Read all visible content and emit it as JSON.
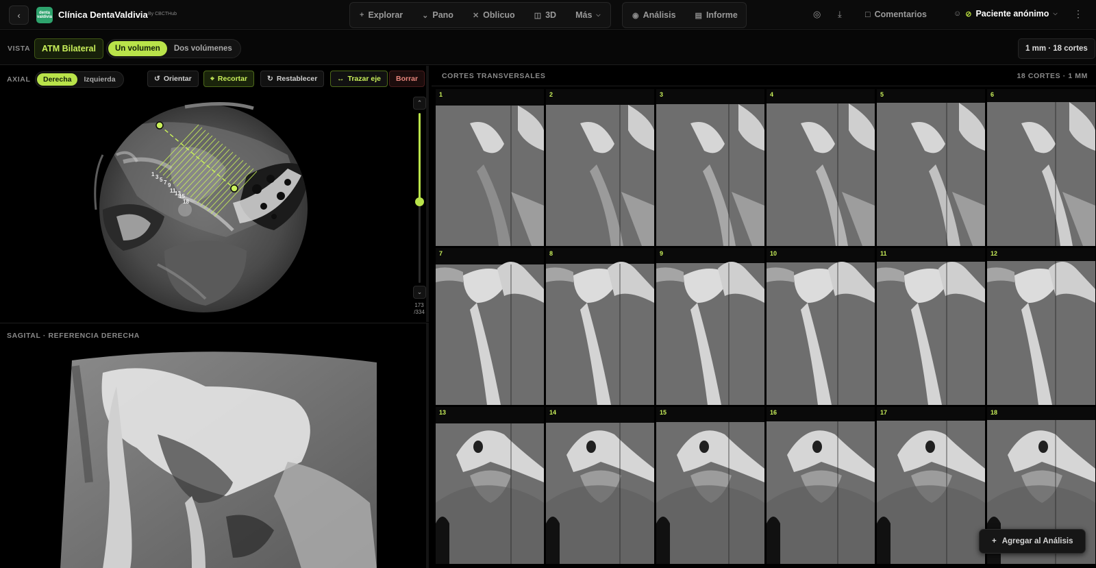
{
  "header": {
    "logo_text": "dental\nvaldivia",
    "brand": "Clínica DentaValdivia",
    "brand_sub": "By CBCTHub",
    "nav": [
      {
        "label": "Explorar",
        "icon": "plus-icon"
      },
      {
        "label": "Pano",
        "icon": "pano-curve-icon"
      },
      {
        "label": "Oblicuo",
        "icon": "oblique-cross-icon"
      },
      {
        "label": "3D",
        "icon": "cube-icon"
      },
      {
        "label": "Más",
        "icon": "chevron-down-icon"
      }
    ],
    "nav2": [
      {
        "label": "Análisis",
        "icon": "eye-icon"
      },
      {
        "label": "Informe",
        "icon": "document-icon"
      }
    ],
    "comments": "Comentarios",
    "patient": "Paciente anónimo"
  },
  "view": {
    "label": "VISTA",
    "mode": "ATM Bilateral",
    "volume_options": [
      "Un volumen",
      "Dos volúmenes"
    ],
    "volume_selected": "Un volumen",
    "slices_info": "1 mm · 18 cortes"
  },
  "axial": {
    "label": "AXIAL",
    "sides": [
      "Derecha",
      "Izquierda"
    ],
    "side_selected": "Derecha",
    "tools": {
      "orient": "Orientar",
      "crop": "Recortar",
      "reset": "Restablecer",
      "axis": "Trazar eje",
      "delete": "Borrar"
    },
    "slice_current": "173",
    "slice_total": "/334",
    "slice_fraction": 0.52,
    "line_labels": [
      "1",
      "3",
      "5",
      "7",
      "9",
      "11",
      "13",
      "15",
      "18"
    ]
  },
  "sagittal": {
    "label": "SAGITAL · REFERENCIA DERECHA"
  },
  "transversal": {
    "title": "CORTES TRANSVERSALES",
    "count": "18 CORTES · 1 MM",
    "slices": [
      "1",
      "2",
      "3",
      "4",
      "5",
      "6",
      "7",
      "8",
      "9",
      "10",
      "11",
      "12",
      "13",
      "14",
      "15",
      "16",
      "17",
      "18"
    ]
  },
  "add_button": "Agregar al Análisis",
  "colors": {
    "accent": "#b9e34a",
    "brand": "#2ea36d",
    "danger": "#e9857c"
  }
}
